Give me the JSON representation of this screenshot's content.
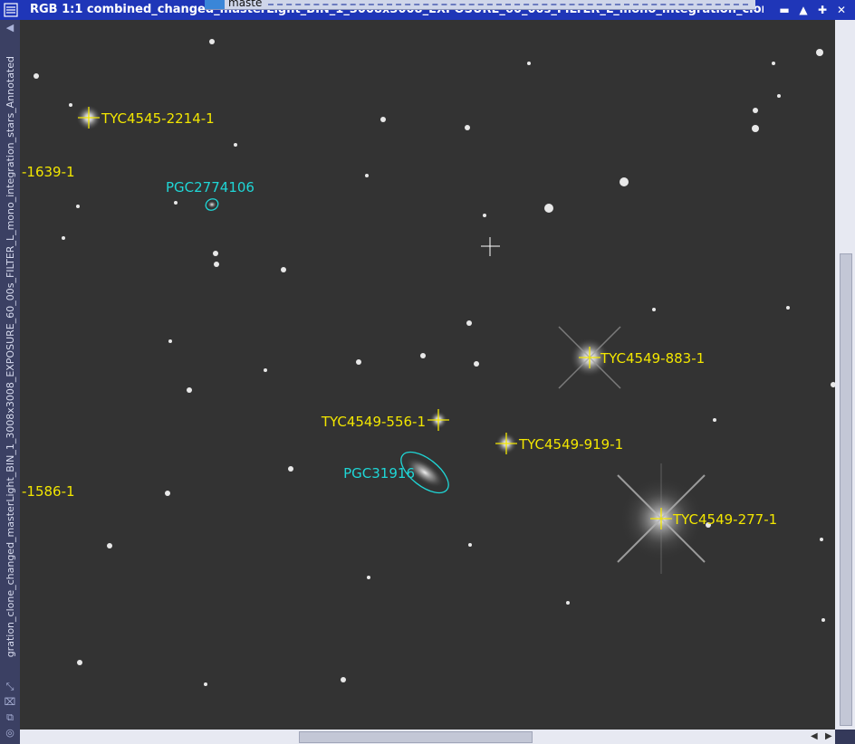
{
  "window": {
    "title": "RGB 1:1 combined_changed_masterLight_BIN_1_3008x3008_EXPOSURE_60_00s_FILTER_L_mono_integration_clon...",
    "overlay_tab_text": "maste",
    "vertical_title": "gration_clone_changed_masterLight_BIN_1_3008x3008_EXPOSURE_60_00s_FILTER_L_mono_integration_stars_Annotated",
    "buttons": {
      "minimize": "▬",
      "shade": "▲",
      "maximize": "✚",
      "close": "✕"
    }
  },
  "annotations": {
    "stars": [
      {
        "label": "TYC4545-2214-1"
      },
      {
        "label": "-1639-1"
      },
      {
        "label": "TYC4549-883-1"
      },
      {
        "label": "TYC4549-556-1"
      },
      {
        "label": "TYC4549-919-1"
      },
      {
        "label": "-1586-1"
      },
      {
        "label": "TYC4549-277-1"
      }
    ],
    "galaxies": [
      {
        "label": "PGC2774106"
      },
      {
        "label": "PGC31916"
      }
    ]
  },
  "colors": {
    "star_label": "#f2e600",
    "galaxy_label": "#1fd6d6",
    "background": "#333333",
    "titlebar": "#1f36b8"
  }
}
